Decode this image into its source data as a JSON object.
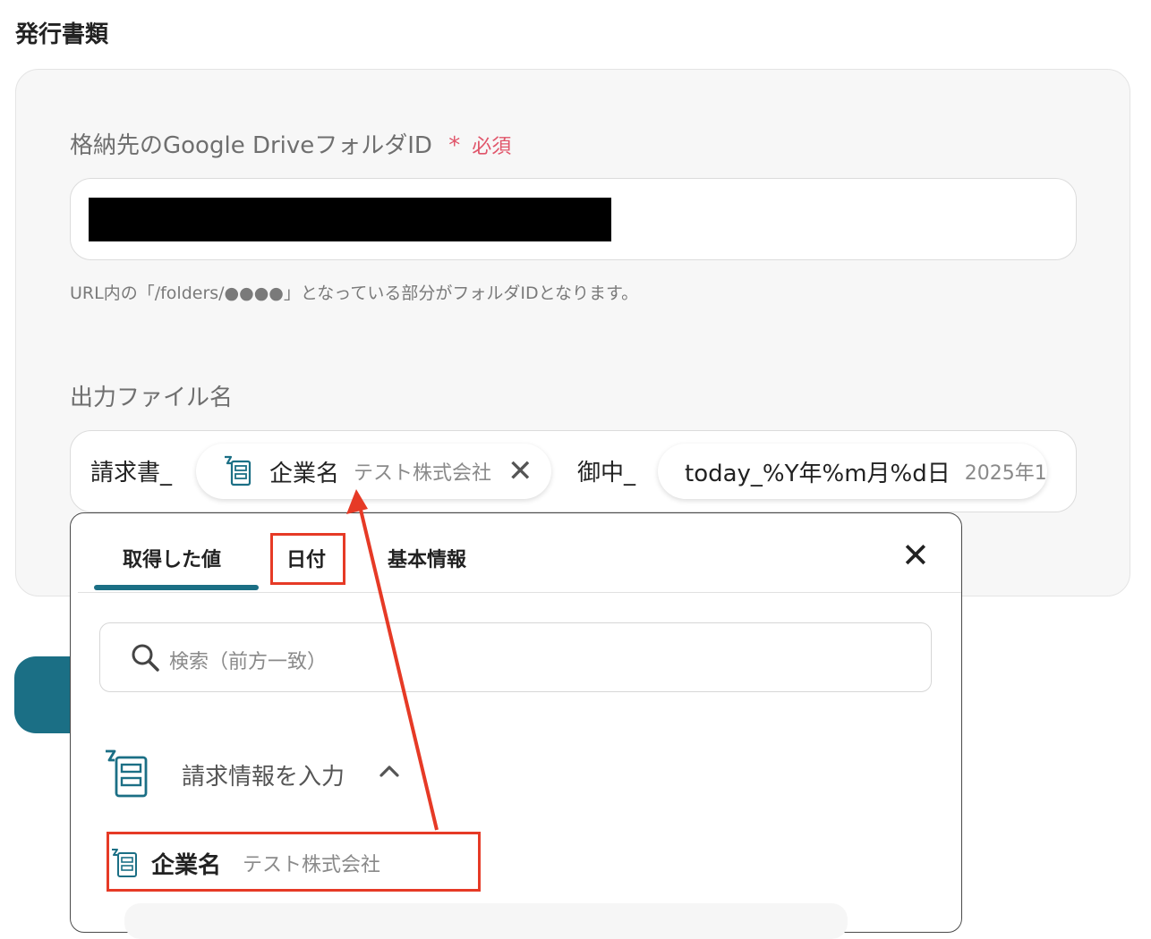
{
  "section": {
    "title": "発行書類"
  },
  "folder_field": {
    "label": "格納先のGoogle DriveフォルダID",
    "required_star": "*",
    "required_label": "必須",
    "hint": "URL内の「/folders/●●●●」となっている部分がフォルダIDとなります。"
  },
  "filename_field": {
    "label": "出力ファイル名",
    "prefix_text": "請求書_",
    "chip1": {
      "label": "企業名",
      "value": "テスト株式会社",
      "close": "✕"
    },
    "middle_text": "御中_",
    "chip2": {
      "label": "today_%Y年%m月%d日",
      "value": "2025年1"
    }
  },
  "dropdown": {
    "tabs": [
      {
        "label": "取得した値",
        "selected": true
      },
      {
        "label": "日付",
        "selected": false
      },
      {
        "label": "基本情報",
        "selected": false
      }
    ],
    "close": "✕",
    "search": {
      "placeholder": "検索（前方一致）"
    },
    "group": {
      "title": "請求情報を入力",
      "expanded": true
    },
    "item": {
      "label": "企業名",
      "value": "テスト株式会社"
    }
  },
  "colors": {
    "accent": "#1b6f85",
    "required": "#e0556a",
    "annotation": "#e63a26"
  },
  "icons": {
    "chip_icon": "form-doc-icon",
    "chip_close": "close-icon",
    "dropdown_close": "close-icon",
    "search": "search-icon",
    "group": "form-doc-icon",
    "group_toggle": "chevron-up-icon",
    "item": "form-doc-icon"
  }
}
